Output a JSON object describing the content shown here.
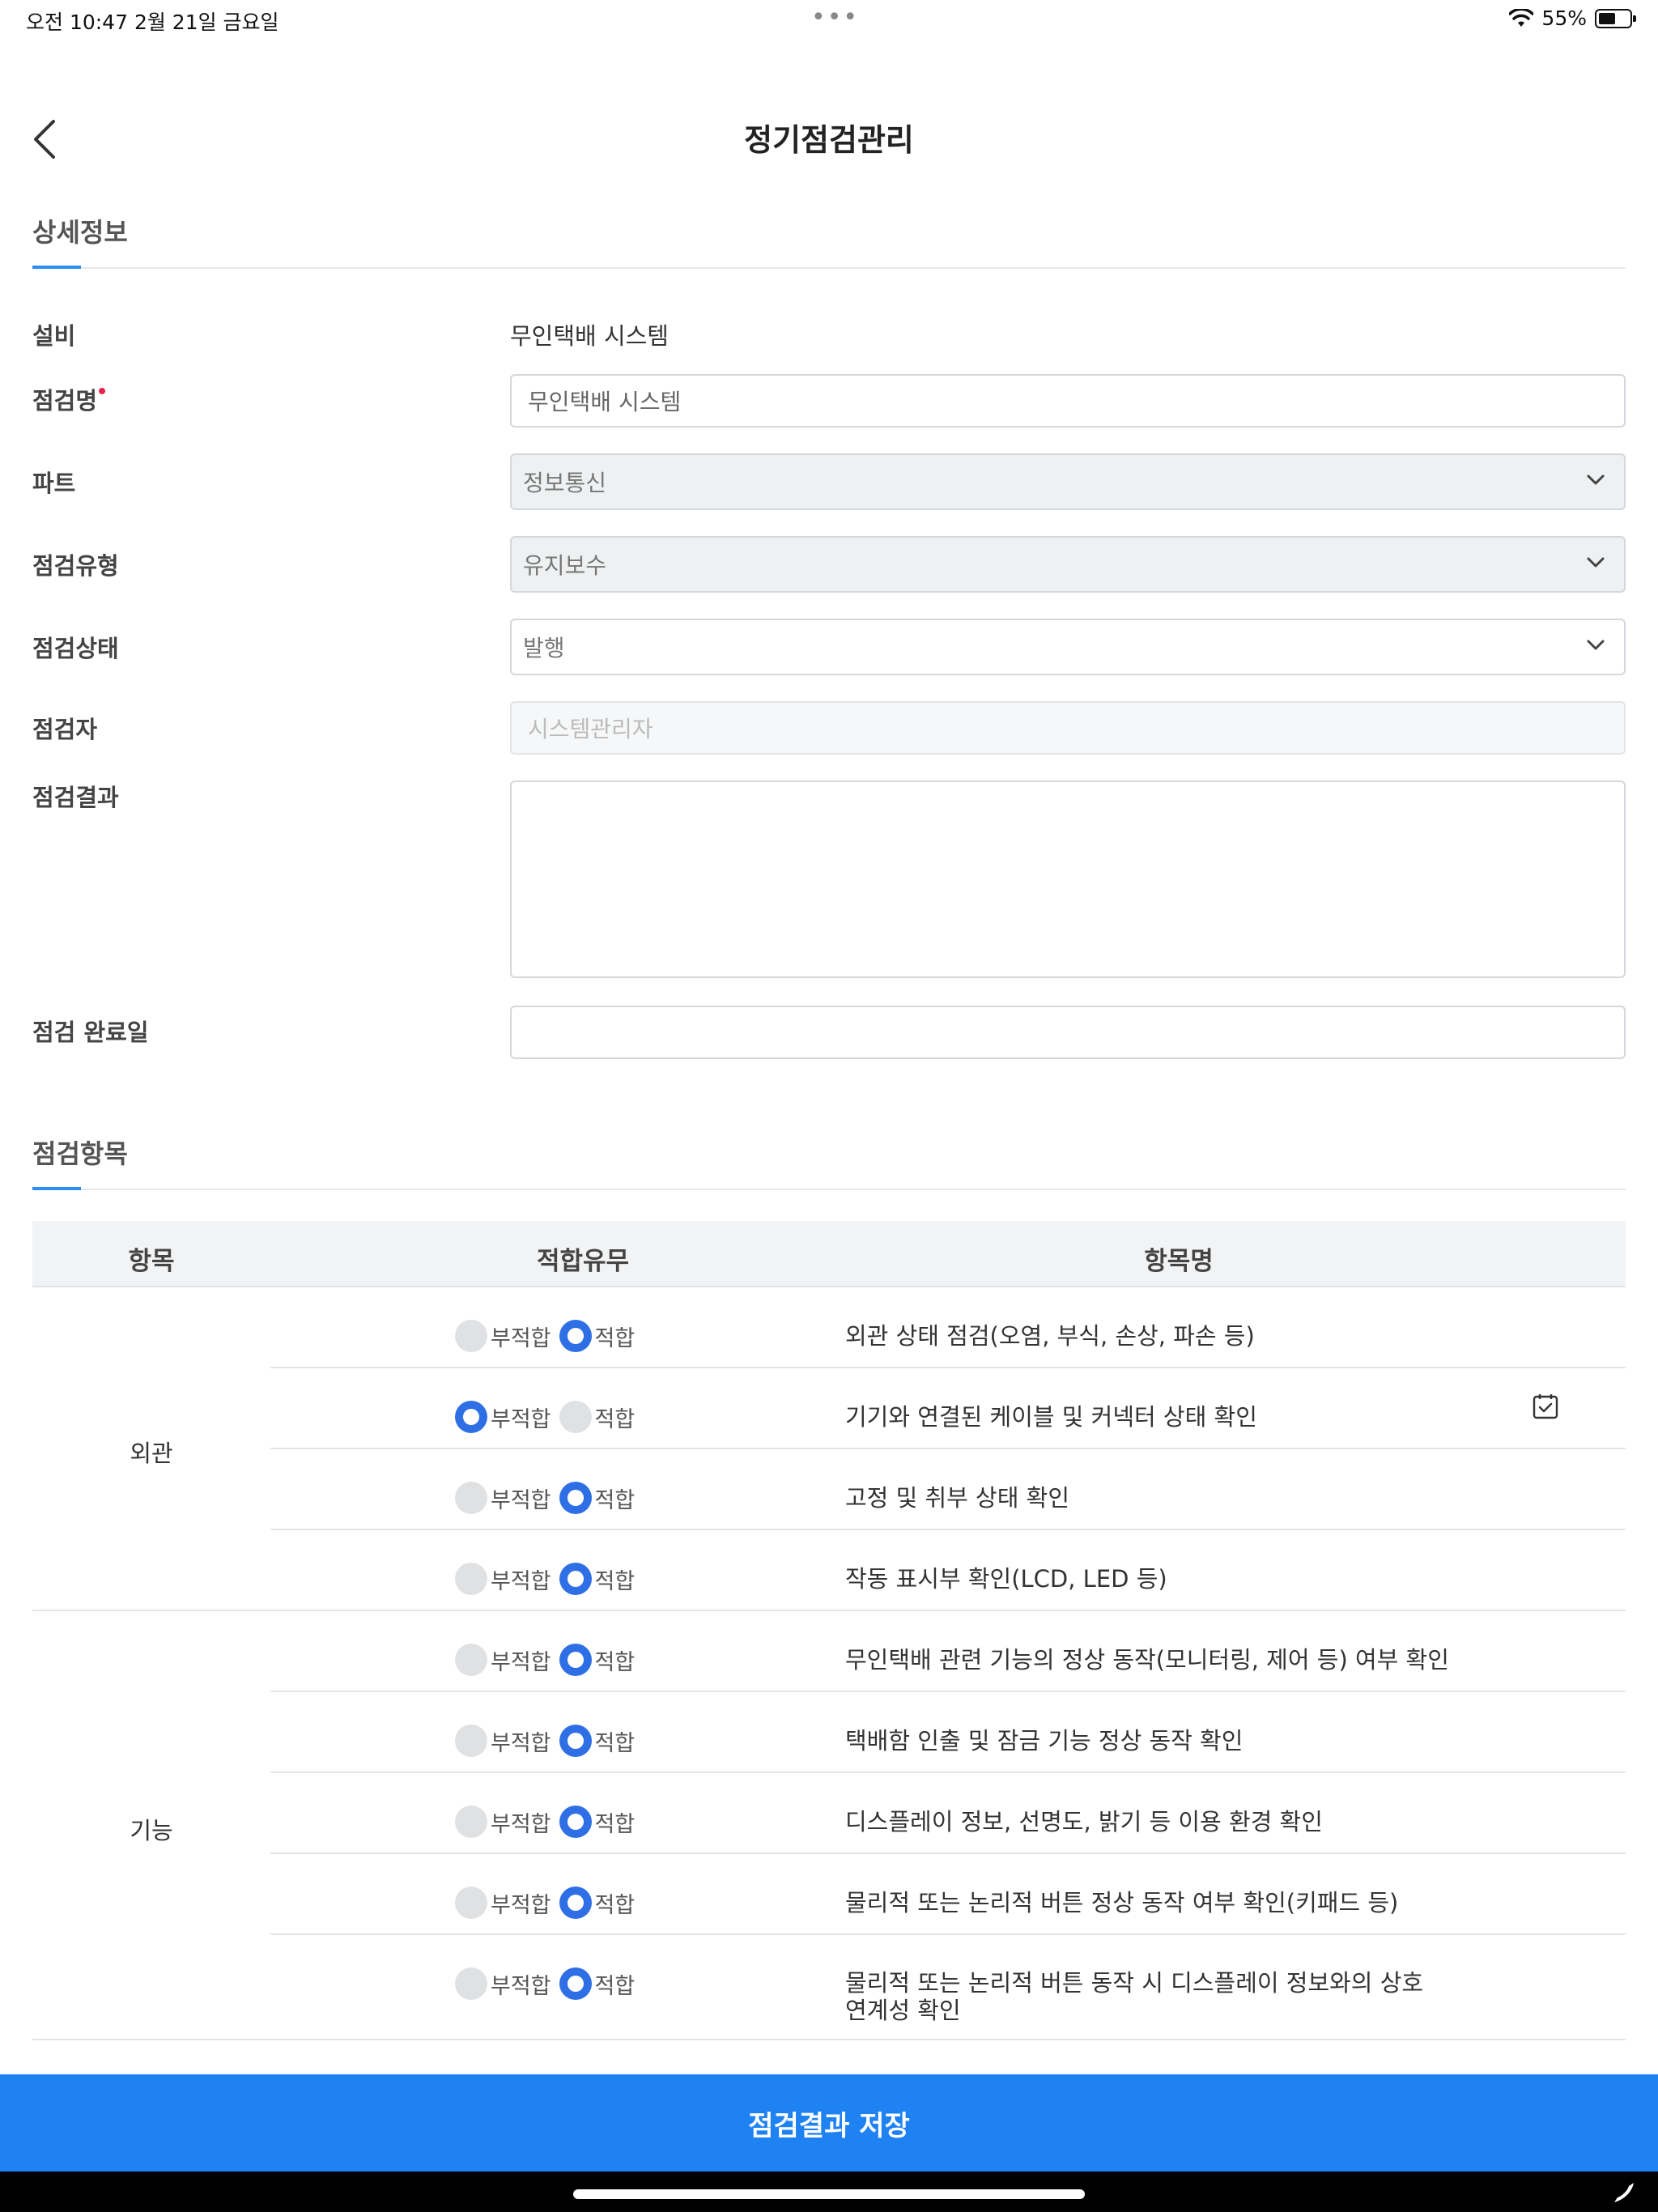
{
  "status_bar": {
    "time_date": "오전 10:47   2월 21일 금요일",
    "dots": "•••",
    "battery_text": "55%",
    "battery_level": 0.55
  },
  "header": {
    "title": "정기점검관리"
  },
  "detail_section": {
    "title": "상세정보"
  },
  "form": {
    "equipment": {
      "label": "설비",
      "value": "무인택배 시스템"
    },
    "inspection_name": {
      "label": "점검명",
      "value": "무인택배 시스템"
    },
    "part": {
      "label": "파트",
      "value": "정보통신"
    },
    "inspection_type": {
      "label": "점검유형",
      "value": "유지보수"
    },
    "inspection_status": {
      "label": "점검상태",
      "value": "발행"
    },
    "inspector": {
      "label": "점검자",
      "value": "시스템관리자"
    },
    "result": {
      "label": "점검결과",
      "value": ""
    },
    "completion_date": {
      "label": "점검 완료일",
      "value": ""
    }
  },
  "items_section": {
    "title": "점검항목"
  },
  "table": {
    "headers": {
      "category": "항목",
      "suitability": "적합유무",
      "item_name": "항목명"
    },
    "radio_labels": {
      "fail": "부적합",
      "pass": "적합"
    },
    "groups": [
      {
        "category": "외관",
        "rows": [
          {
            "name": "외관 상태 점검(오염, 부식, 손상, 파손 등)",
            "selected": "pass"
          },
          {
            "name": "기기와 연결된 케이블 및 커넥터 상태 확인",
            "selected": "fail"
          },
          {
            "name": "고정 및 취부 상태 확인",
            "selected": "pass"
          },
          {
            "name": "작동 표시부 확인(LCD, LED 등)",
            "selected": "pass"
          }
        ]
      },
      {
        "category": "기능",
        "rows": [
          {
            "name": "무인택배 관련 기능의 정상 동작(모니터링, 제어 등) 여부 확인",
            "selected": "pass"
          },
          {
            "name": "택배함 인출 및 잠금 기능 정상 동작 확인",
            "selected": "pass"
          },
          {
            "name": "디스플레이 정보, 선명도, 밝기 등 이용 환경 확인",
            "selected": "pass"
          },
          {
            "name": "물리적 또는 논리적 버튼 정상 동작 여부 확인(키패드 등)",
            "selected": "pass"
          },
          {
            "name": "물리적 또는 논리적 버튼 동작 시 디스플레이 정보와의 상호",
            "name_line2": "연계성 확인",
            "selected": "pass"
          }
        ]
      }
    ]
  },
  "save_button": {
    "label": "점검결과 저장"
  },
  "colors": {
    "accent": "#1f82f2",
    "radio_on": "#2f6fe6",
    "required": "#e8234a"
  }
}
